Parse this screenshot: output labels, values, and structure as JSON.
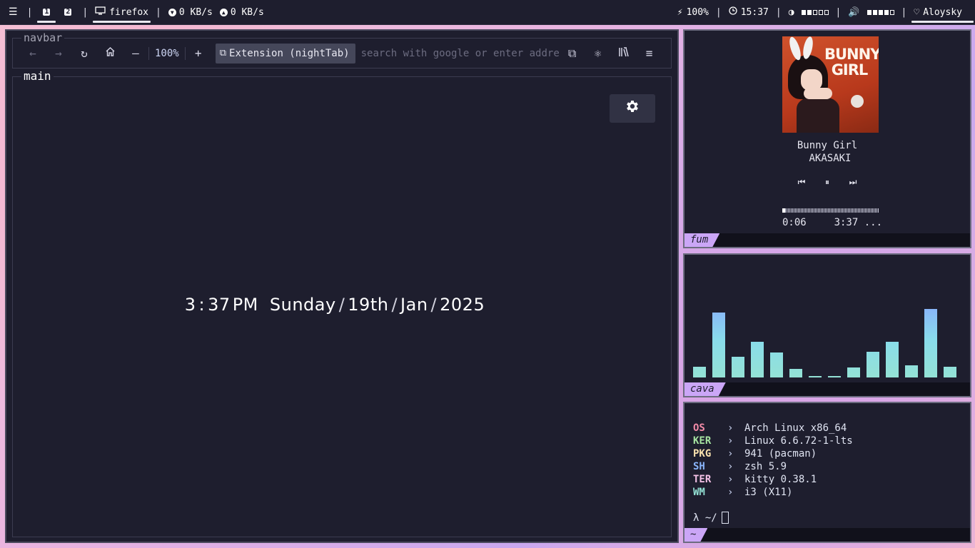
{
  "topbar": {
    "menu_icon": "list-icon",
    "workspaces": [
      "1",
      "2"
    ],
    "window_title": "firefox",
    "net_down": "0 KB/s",
    "net_up": "0 KB/s",
    "battery": "100%",
    "time": "15:37",
    "brightness_level": 0.4,
    "volume_level": 0.8,
    "user": "Aloysky",
    "separator": "|"
  },
  "browser": {
    "navbar_label": "navbar",
    "main_label": "main",
    "zoom": "100%",
    "extension_chip": "Extension (nightTab)",
    "url_placeholder": "search with google or enter address"
  },
  "newtab": {
    "hour": "3",
    "colon": ":",
    "minutes": "37",
    "ampm": "PM",
    "day": "Sunday",
    "date": "19th",
    "month": "Jan",
    "year": "2025",
    "slash": "/"
  },
  "music": {
    "cover_title_line1": "BUNNY",
    "cover_title_line2": "GIRL",
    "track": "Bunny Girl",
    "artist": "AKASAKI",
    "elapsed": "0:06",
    "total": "3:37 ...",
    "progress_fraction": 0.03,
    "tag": "fum"
  },
  "cava": {
    "tag": "cava",
    "bar_levels": [
      0.1,
      0.6,
      0.19,
      0.33,
      0.23,
      0.08,
      0.01,
      0.01,
      0.09,
      0.24,
      0.33,
      0.11,
      0.63,
      0.1
    ]
  },
  "fetch": {
    "tag": "~",
    "arrow": "›",
    "rows": [
      {
        "key": "OS",
        "value": "Arch Linux x86_64",
        "color": "#f38ba8"
      },
      {
        "key": "KER",
        "value": "Linux 6.6.72-1-lts",
        "color": "#a6e3a1"
      },
      {
        "key": "PKG",
        "value": "941 (pacman)",
        "color": "#f9e2af"
      },
      {
        "key": "SH",
        "value": "zsh 5.9",
        "color": "#89b4fa"
      },
      {
        "key": "TER",
        "value": "kitty 0.38.1",
        "color": "#f5c2e7"
      },
      {
        "key": "WM",
        "value": "i3 (X11)",
        "color": "#94e2d5"
      }
    ],
    "prompt": "λ ~/"
  }
}
